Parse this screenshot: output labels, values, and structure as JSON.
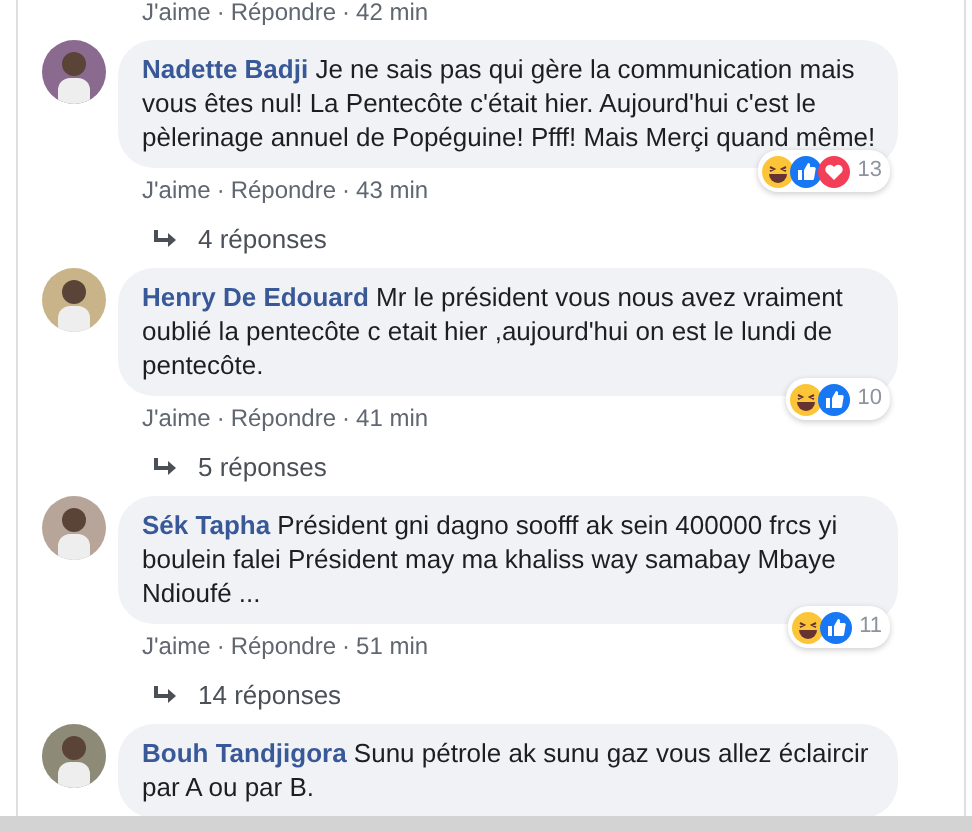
{
  "top_actions": {
    "like": "J'aime",
    "sep1": "·",
    "reply": "Répondre",
    "sep2": "·",
    "time": "42 min"
  },
  "comments": [
    {
      "author": "Nadette Badji",
      "text": "Je ne sais pas qui gère la communication mais vous êtes nul! La Pentecôte c'était hier. Aujourd'hui c'est le pèlerinage annuel de Popéguine! Pfff! Mais Merçi quand même!",
      "reactions": [
        {
          "kind": "haha"
        },
        {
          "kind": "like"
        },
        {
          "kind": "love"
        }
      ],
      "reaction_count": "13",
      "like": "J'aime",
      "sep1": "·",
      "reply": "Répondre",
      "sep2": "·",
      "time": "43 min",
      "replies": "4 réponses"
    },
    {
      "author": "Henry De Edouard",
      "text": "Mr le président vous nous avez vraiment oublié la pentecôte c etait hier ,aujourd'hui on est le lundi de pentecôte.",
      "reactions": [
        {
          "kind": "haha"
        },
        {
          "kind": "like"
        }
      ],
      "reaction_count": "10",
      "like": "J'aime",
      "sep1": "·",
      "reply": "Répondre",
      "sep2": "·",
      "time": "41 min",
      "replies": "5 réponses"
    },
    {
      "author": "Sék Tapha",
      "text": "Président gni dagno soofff ak sein 400000 frcs yi boulein falei Président may ma khaliss way samabay Mbaye Ndioufé ...",
      "reactions": [
        {
          "kind": "haha"
        },
        {
          "kind": "like"
        }
      ],
      "reaction_count": "11",
      "like": "J'aime",
      "sep1": "·",
      "reply": "Répondre",
      "sep2": "·",
      "time": "51 min",
      "replies": "14 réponses"
    },
    {
      "author": "Bouh Tandjigora",
      "text": "Sunu pétrole ak sunu gaz vous allez éclaircir par A ou par B."
    }
  ]
}
